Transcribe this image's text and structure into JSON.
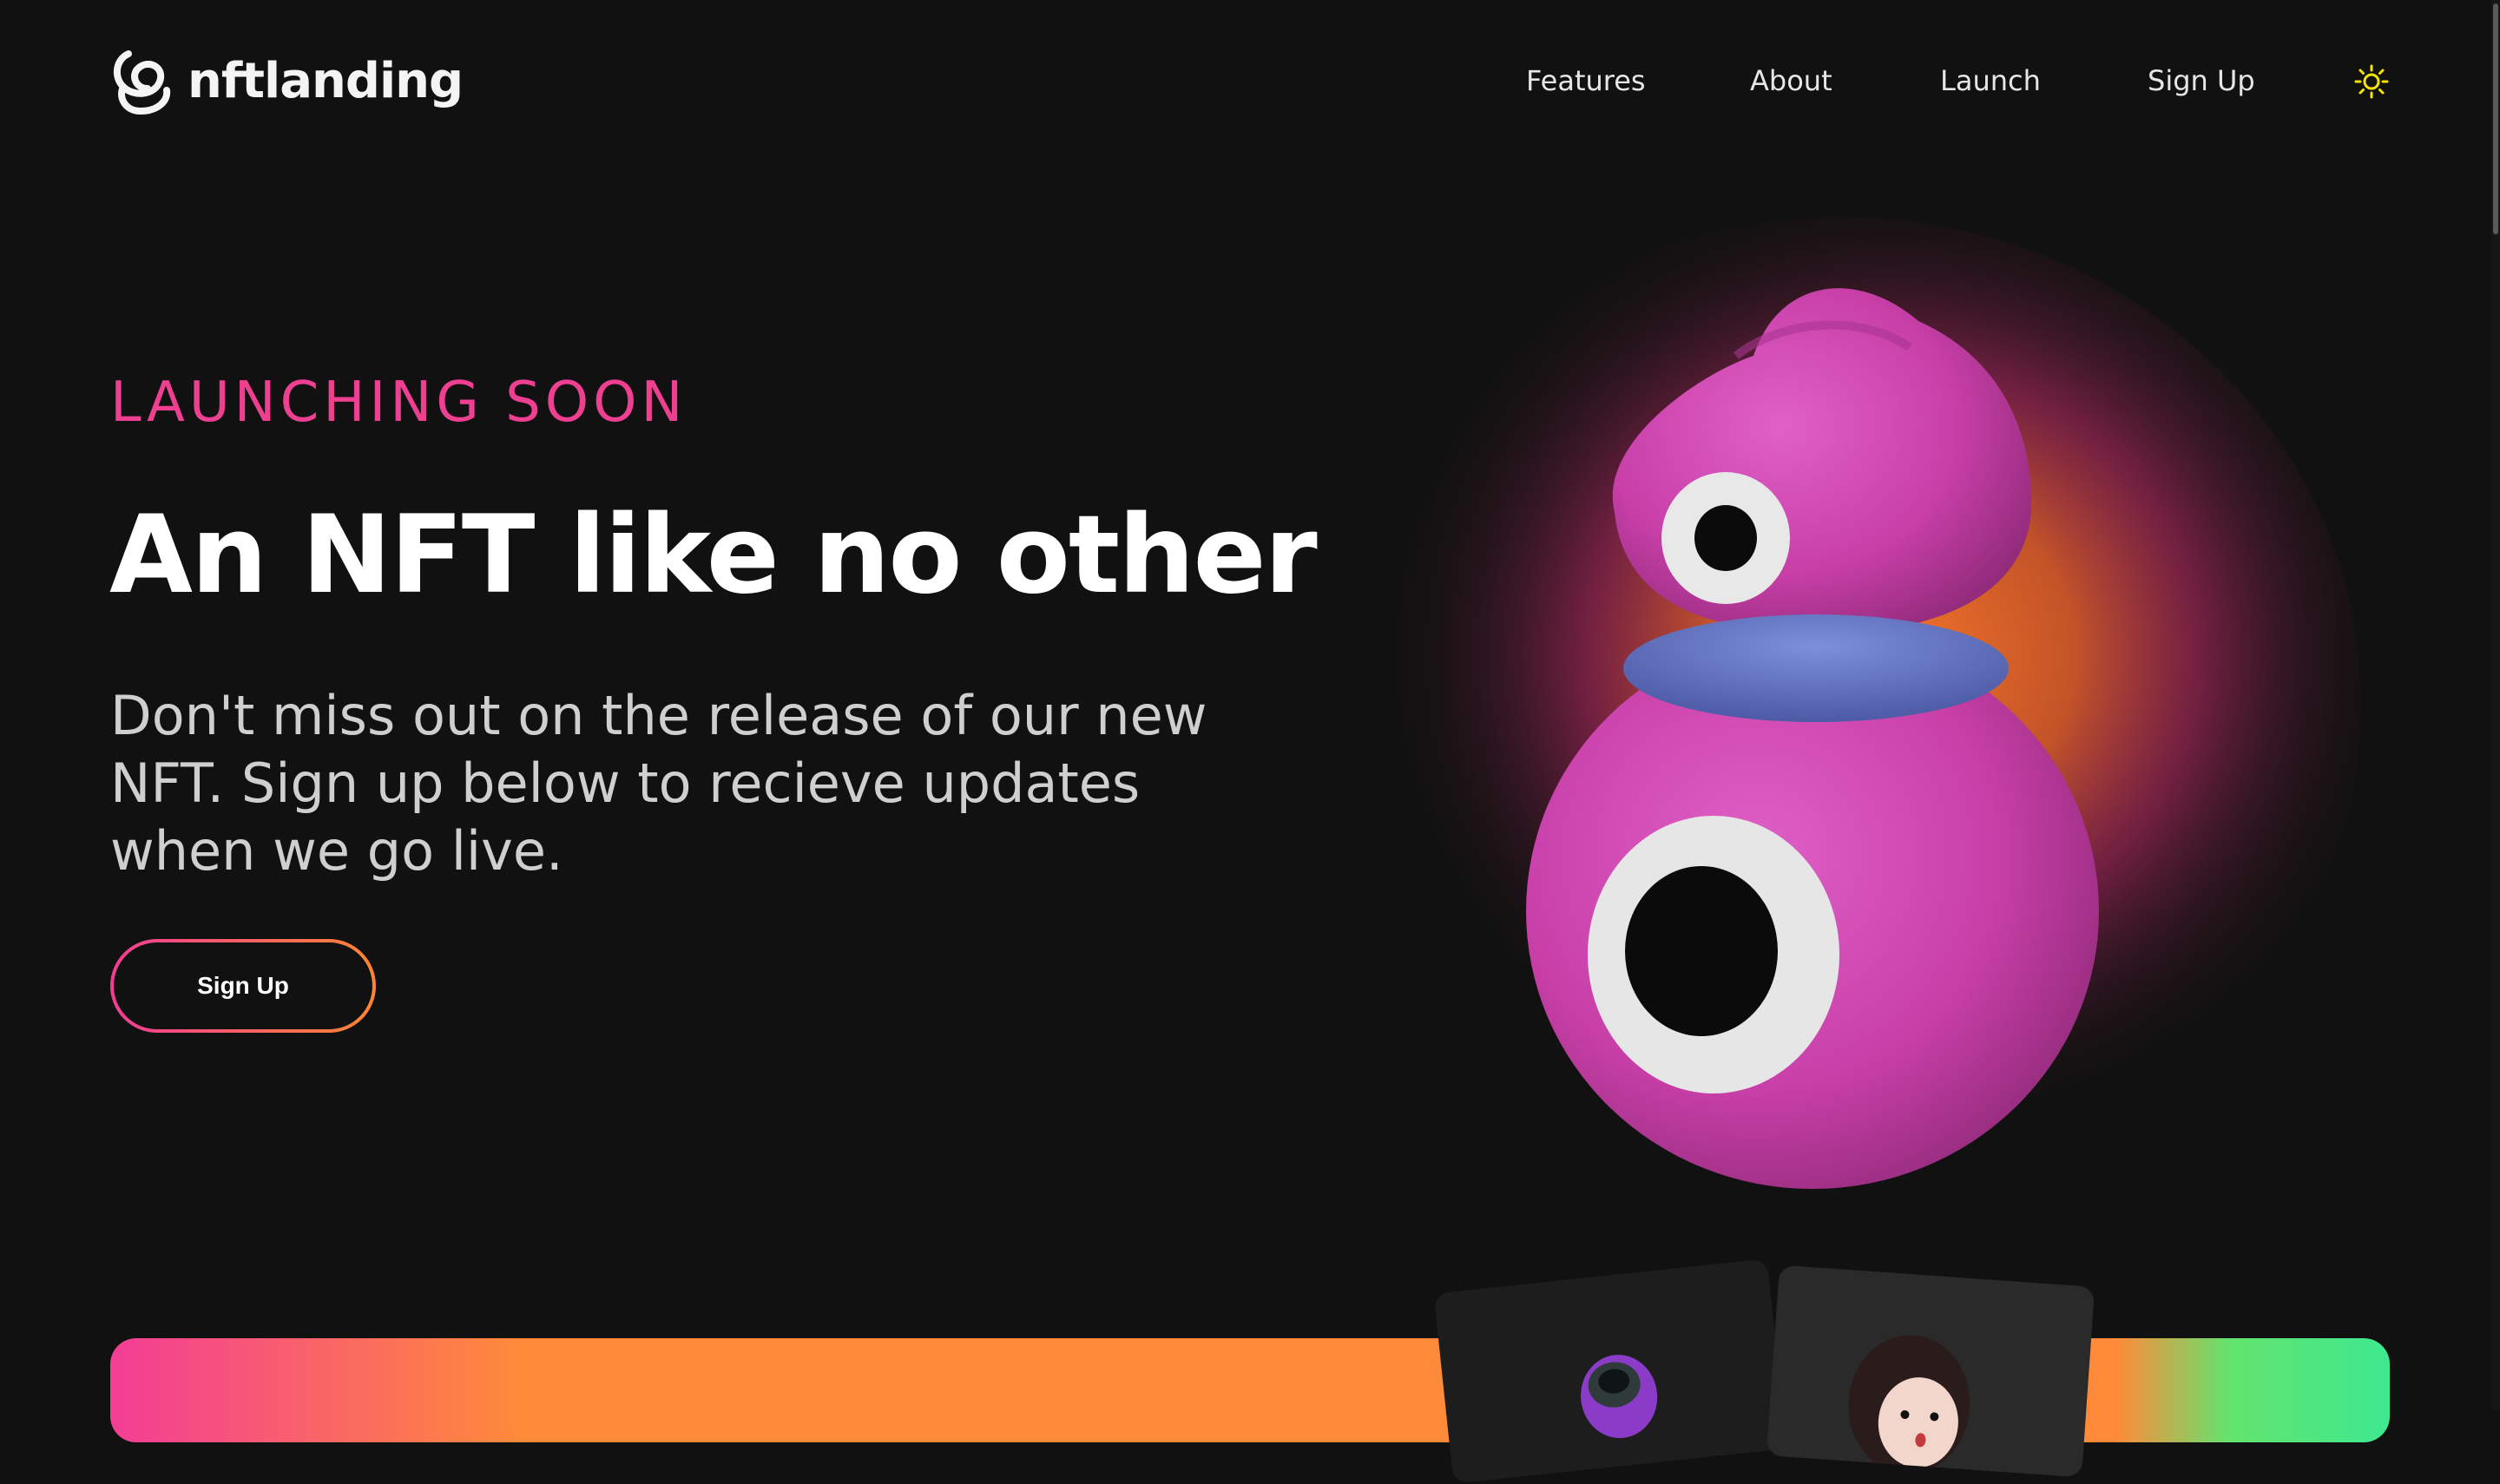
{
  "brand": {
    "name": "nftlanding",
    "logo_icon": "swirl-logo-icon"
  },
  "nav": {
    "items": [
      {
        "label": "Features"
      },
      {
        "label": "About"
      },
      {
        "label": "Launch"
      },
      {
        "label": "Sign Up"
      }
    ],
    "theme_toggle_icon": "sun-icon"
  },
  "hero": {
    "eyebrow": "LAUNCHING SOON",
    "title": "An NFT like no other",
    "description": "Don't miss out on the release of our new NFT. Sign up below to recieve updates when we go live.",
    "cta_label": "Sign Up",
    "illustration": "pink-cyclops-nft-character"
  },
  "preview_cards": [
    {
      "image": "purple-helmet-character"
    },
    {
      "image": "dark-haired-doll-character"
    }
  ],
  "colors": {
    "background": "#111111",
    "accent_pink": "#ee3f91",
    "accent_orange": "#ff8533",
    "accent_green": "#3ee891",
    "sun_icon": "#f5e400"
  }
}
